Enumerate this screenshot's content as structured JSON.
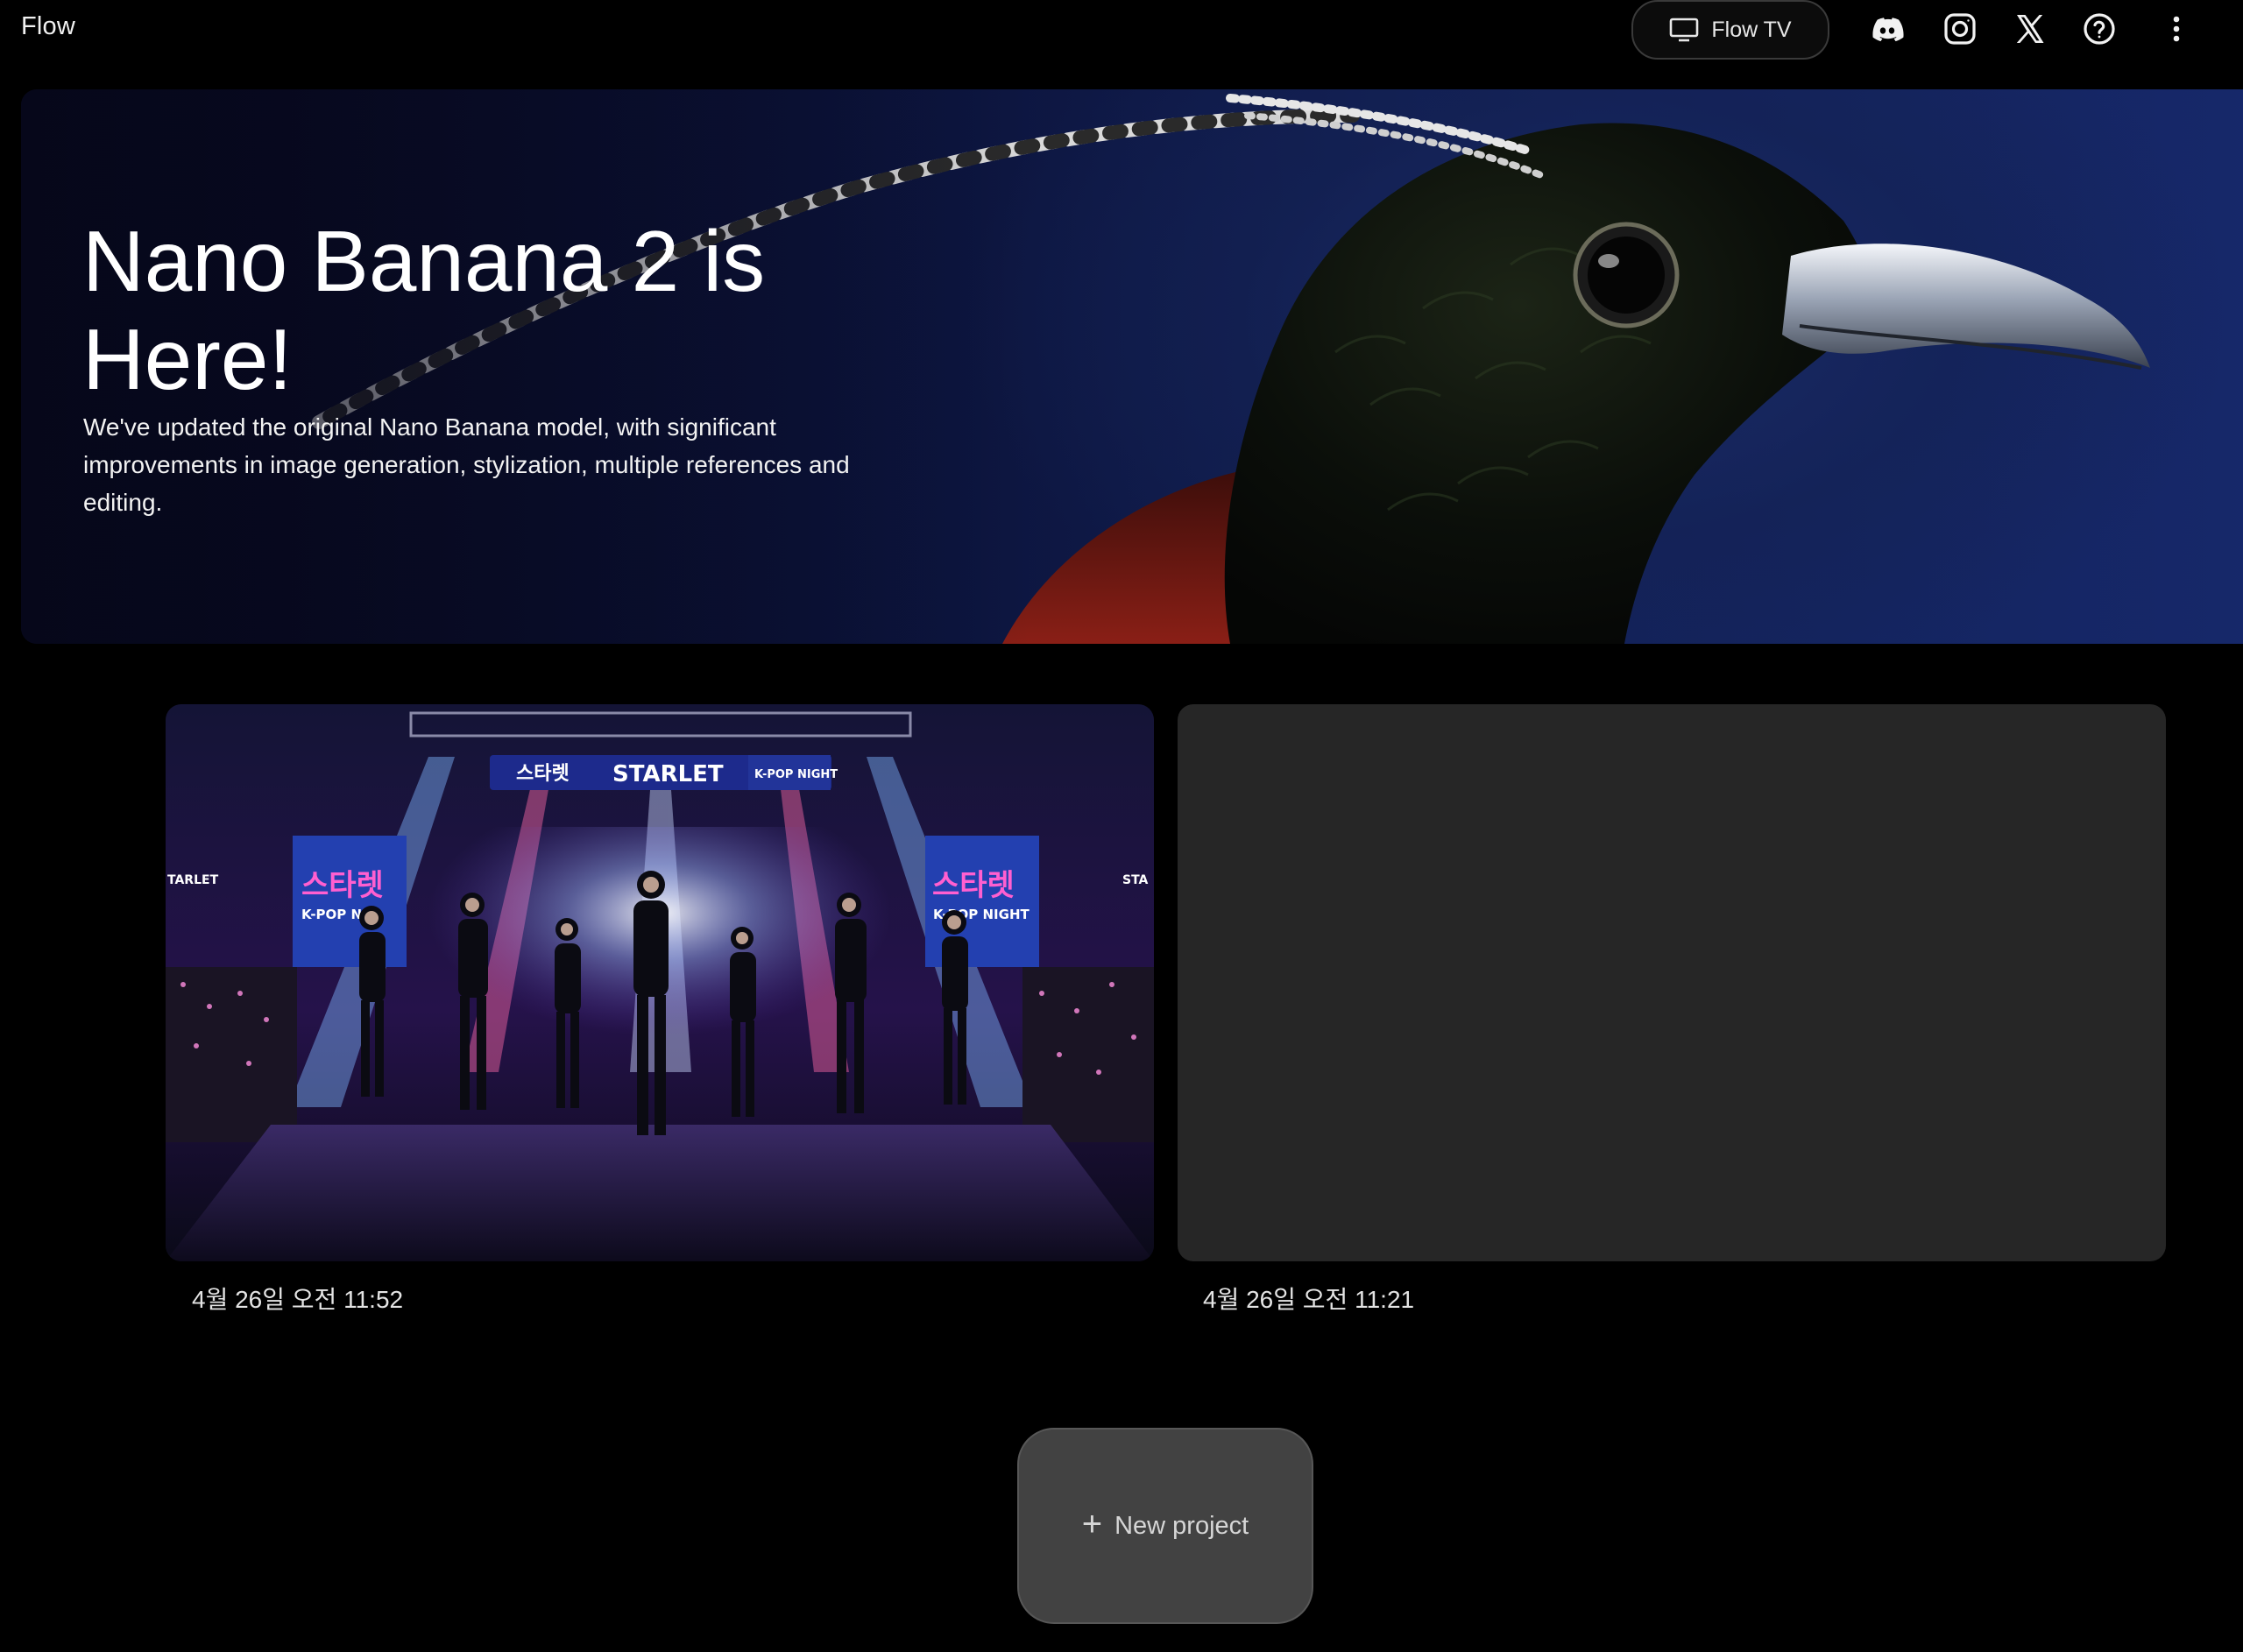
{
  "app": {
    "name": "Flow"
  },
  "header": {
    "flow_tv_label": "Flow TV",
    "icons": [
      "tv-icon",
      "discord-icon",
      "instagram-icon",
      "x-icon",
      "help-icon",
      "more-vert-icon"
    ]
  },
  "hero": {
    "title": "Nano Banana 2 is Here!",
    "description": "We've updated the original Nano Banana model, with significant improvements in image generation, stylization, multiple references and editing."
  },
  "projects": [
    {
      "date": "4월 26일 오전 11:52",
      "thumbnail": {
        "banner_main": "STARLET",
        "banner_left": "스타렛",
        "banner_right": "K-POP NIGHT",
        "screen_left_title": "스타렛",
        "screen_left_sub": "K-POP NI",
        "screen_right_title": "스타렛",
        "screen_right_sub": "K-POP NIGHT",
        "side_left": "TARLET",
        "side_right": "STA"
      }
    },
    {
      "date": "4월 26일 오전 11:21"
    }
  ],
  "new_project": {
    "label": "New project"
  },
  "colors": {
    "background": "#000000",
    "card_placeholder": "#262626",
    "button_bg": "#424242"
  }
}
